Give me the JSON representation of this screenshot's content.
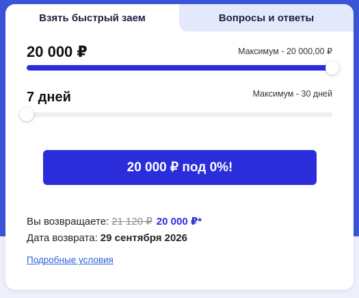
{
  "tabs": [
    {
      "label": "Взять быстрый заем"
    },
    {
      "label": "Вопросы и ответы"
    }
  ],
  "amount": {
    "value": "20 000 ₽",
    "max_label": "Максимум - 20 000,00 ₽",
    "fill_fraction": 1.0
  },
  "term": {
    "value": "7 дней",
    "max_label": "Максимум - 30 дней",
    "fill_fraction": 0.0
  },
  "cta": {
    "label": "20 000 ₽ под 0%!"
  },
  "summary": {
    "return_label": "Вы возвращаете:",
    "old_amount": "21 120 ₽",
    "new_amount": "20 000 ₽*",
    "date_label": "Дата возврата:",
    "date_value": "29 сентября 2026"
  },
  "details_link": "Подробные условия",
  "colors": {
    "accent": "#2b2ddb",
    "header_bg": "#3a55d9"
  }
}
